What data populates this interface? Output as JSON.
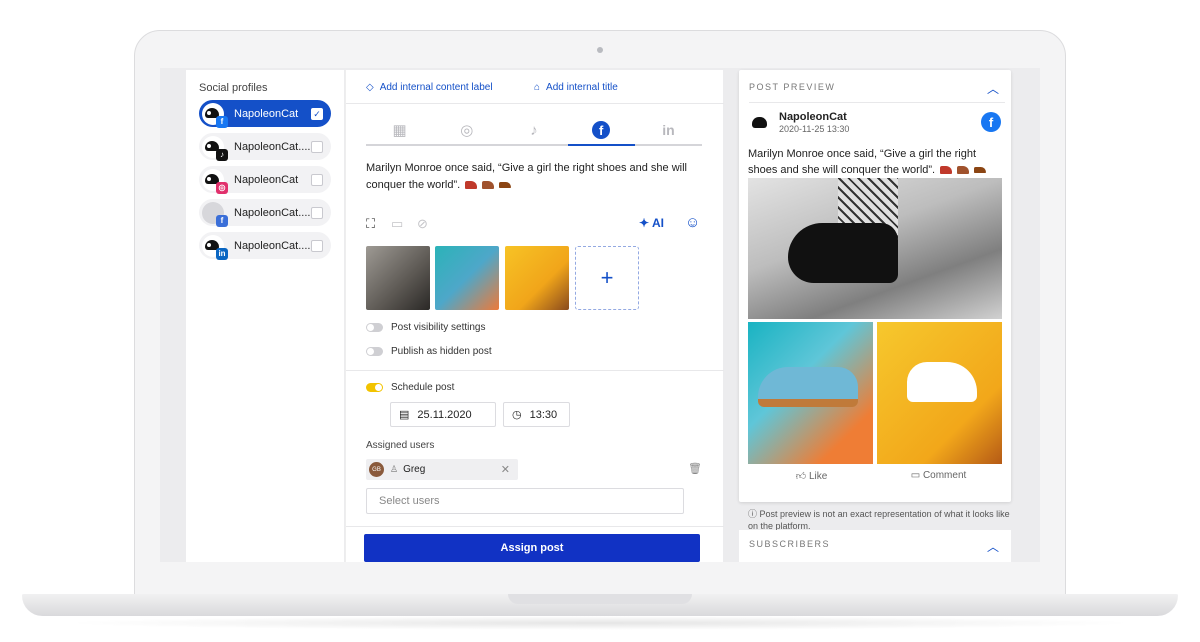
{
  "profiles": {
    "title": "Social profiles",
    "items": [
      {
        "name": "NapoleonCat",
        "network": "facebook",
        "badge": "f",
        "badge_color": "#1877f2",
        "checked": true
      },
      {
        "name": "NapoleonCat....",
        "network": "tiktok",
        "badge": "♪",
        "badge_color": "#111111",
        "checked": false
      },
      {
        "name": "NapoleonCat",
        "network": "instagram",
        "badge": "◎",
        "badge_color": "#e1306c",
        "checked": false
      },
      {
        "name": "NapoleonCat....",
        "network": "facebook-group",
        "badge": "f",
        "badge_color": "#3b6fd8",
        "checked": false
      },
      {
        "name": "NapoleonCat....",
        "network": "linkedin",
        "badge": "in",
        "badge_color": "#0a66c2",
        "checked": false
      }
    ]
  },
  "editor": {
    "add_label": "Add internal content label",
    "add_title": "Add internal title",
    "tabs": [
      "google-business-icon",
      "instagram-icon",
      "tiktok-icon",
      "facebook-icon",
      "linkedin-icon"
    ],
    "active_tab": "facebook-icon",
    "post_text": "Marilyn Monroe once said, “Give a girl the right shoes and she will conquer the world”.",
    "ai_label": "AI",
    "add_media": "+",
    "visibility_label": "Post visibility settings",
    "hidden_label": "Publish as hidden post",
    "schedule_label": "Schedule post",
    "date": "25.11.2020",
    "time": "13:30",
    "assigned_label": "Assigned users",
    "user_initials": "GB",
    "user_name": "Greg",
    "select_placeholder": "Select users",
    "assign_button": "Assign post"
  },
  "preview": {
    "title": "POST PREVIEW",
    "page_name": "NapoleonCat",
    "timestamp": "2020-11-25 13:30",
    "text": "Marilyn Monroe once said, “Give a girl the right shoes and she will conquer the world”.",
    "like": "Like",
    "comment": "Comment",
    "note": "Post preview is not an exact representation of what it looks like on the platform.",
    "subscribers": "SUBSCRIBERS"
  },
  "colors": {
    "accent": "#1450c8",
    "button": "#1132c4",
    "toggle_on": "#f2c300"
  }
}
